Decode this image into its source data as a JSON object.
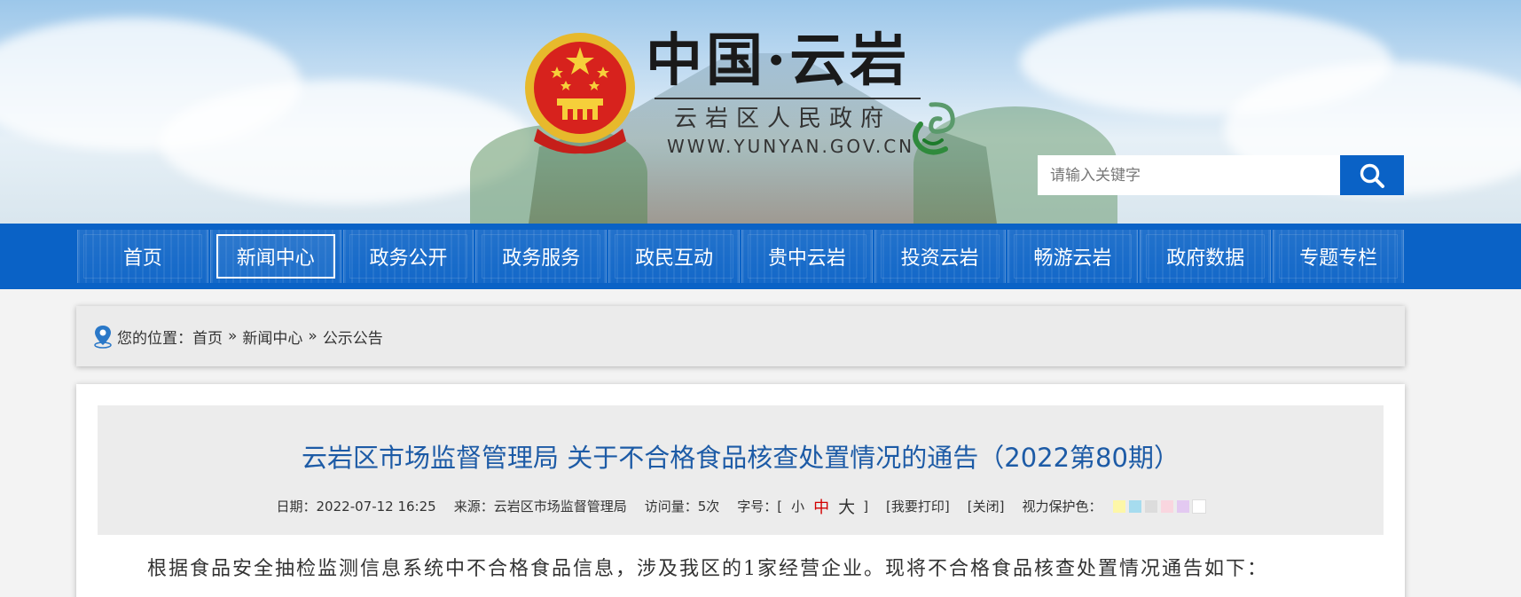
{
  "site": {
    "title": "中国·云岩",
    "subtitle": "云岩区人民政府",
    "url": "WWW.YUNYAN.GOV.CN"
  },
  "search": {
    "placeholder": "请输入关键字",
    "button_icon": "search-icon"
  },
  "nav": {
    "items": [
      {
        "label": "首页",
        "active": false
      },
      {
        "label": "新闻中心",
        "active": true
      },
      {
        "label": "政务公开",
        "active": false
      },
      {
        "label": "政务服务",
        "active": false
      },
      {
        "label": "政民互动",
        "active": false
      },
      {
        "label": "贵中云岩",
        "active": false
      },
      {
        "label": "投资云岩",
        "active": false
      },
      {
        "label": "畅游云岩",
        "active": false
      },
      {
        "label": "政府数据",
        "active": false
      },
      {
        "label": "专题专栏",
        "active": false
      }
    ]
  },
  "breadcrumb": {
    "prefix": "您的位置：",
    "items": [
      "首页",
      "新闻中心",
      "公示公告"
    ],
    "separator": "»"
  },
  "article": {
    "title": "云岩区市场监督管理局 关于不合格食品核查处置情况的通告（2022第80期）",
    "meta": {
      "date_label": "日期：",
      "date": "2022-07-12 16:25",
      "source_label": "来源：",
      "source": "云岩区市场监督管理局",
      "visits_label": "访问量：",
      "visits": "5次",
      "fontsize_label": "字号：",
      "bracket_open": "[",
      "bracket_close": "]",
      "font_small": "小",
      "font_medium": "中",
      "font_large": "大",
      "print": "[我要打印]",
      "close": "[关闭]",
      "eye_label": "视力保护色："
    },
    "eye_colors": [
      "#fdf7a8",
      "#a6dcef",
      "#dcdcdc",
      "#f9d6df",
      "#e3c9f1",
      "#ffffff"
    ],
    "body": "根据食品安全抽检监测信息系统中不合格食品信息，涉及我区的1家经营企业。现将不合格食品核查处置情况通告如下："
  },
  "colors": {
    "nav_blue": "#0a62c6",
    "title_blue": "#1d5ba6",
    "font_mid_red": "#d20000"
  }
}
